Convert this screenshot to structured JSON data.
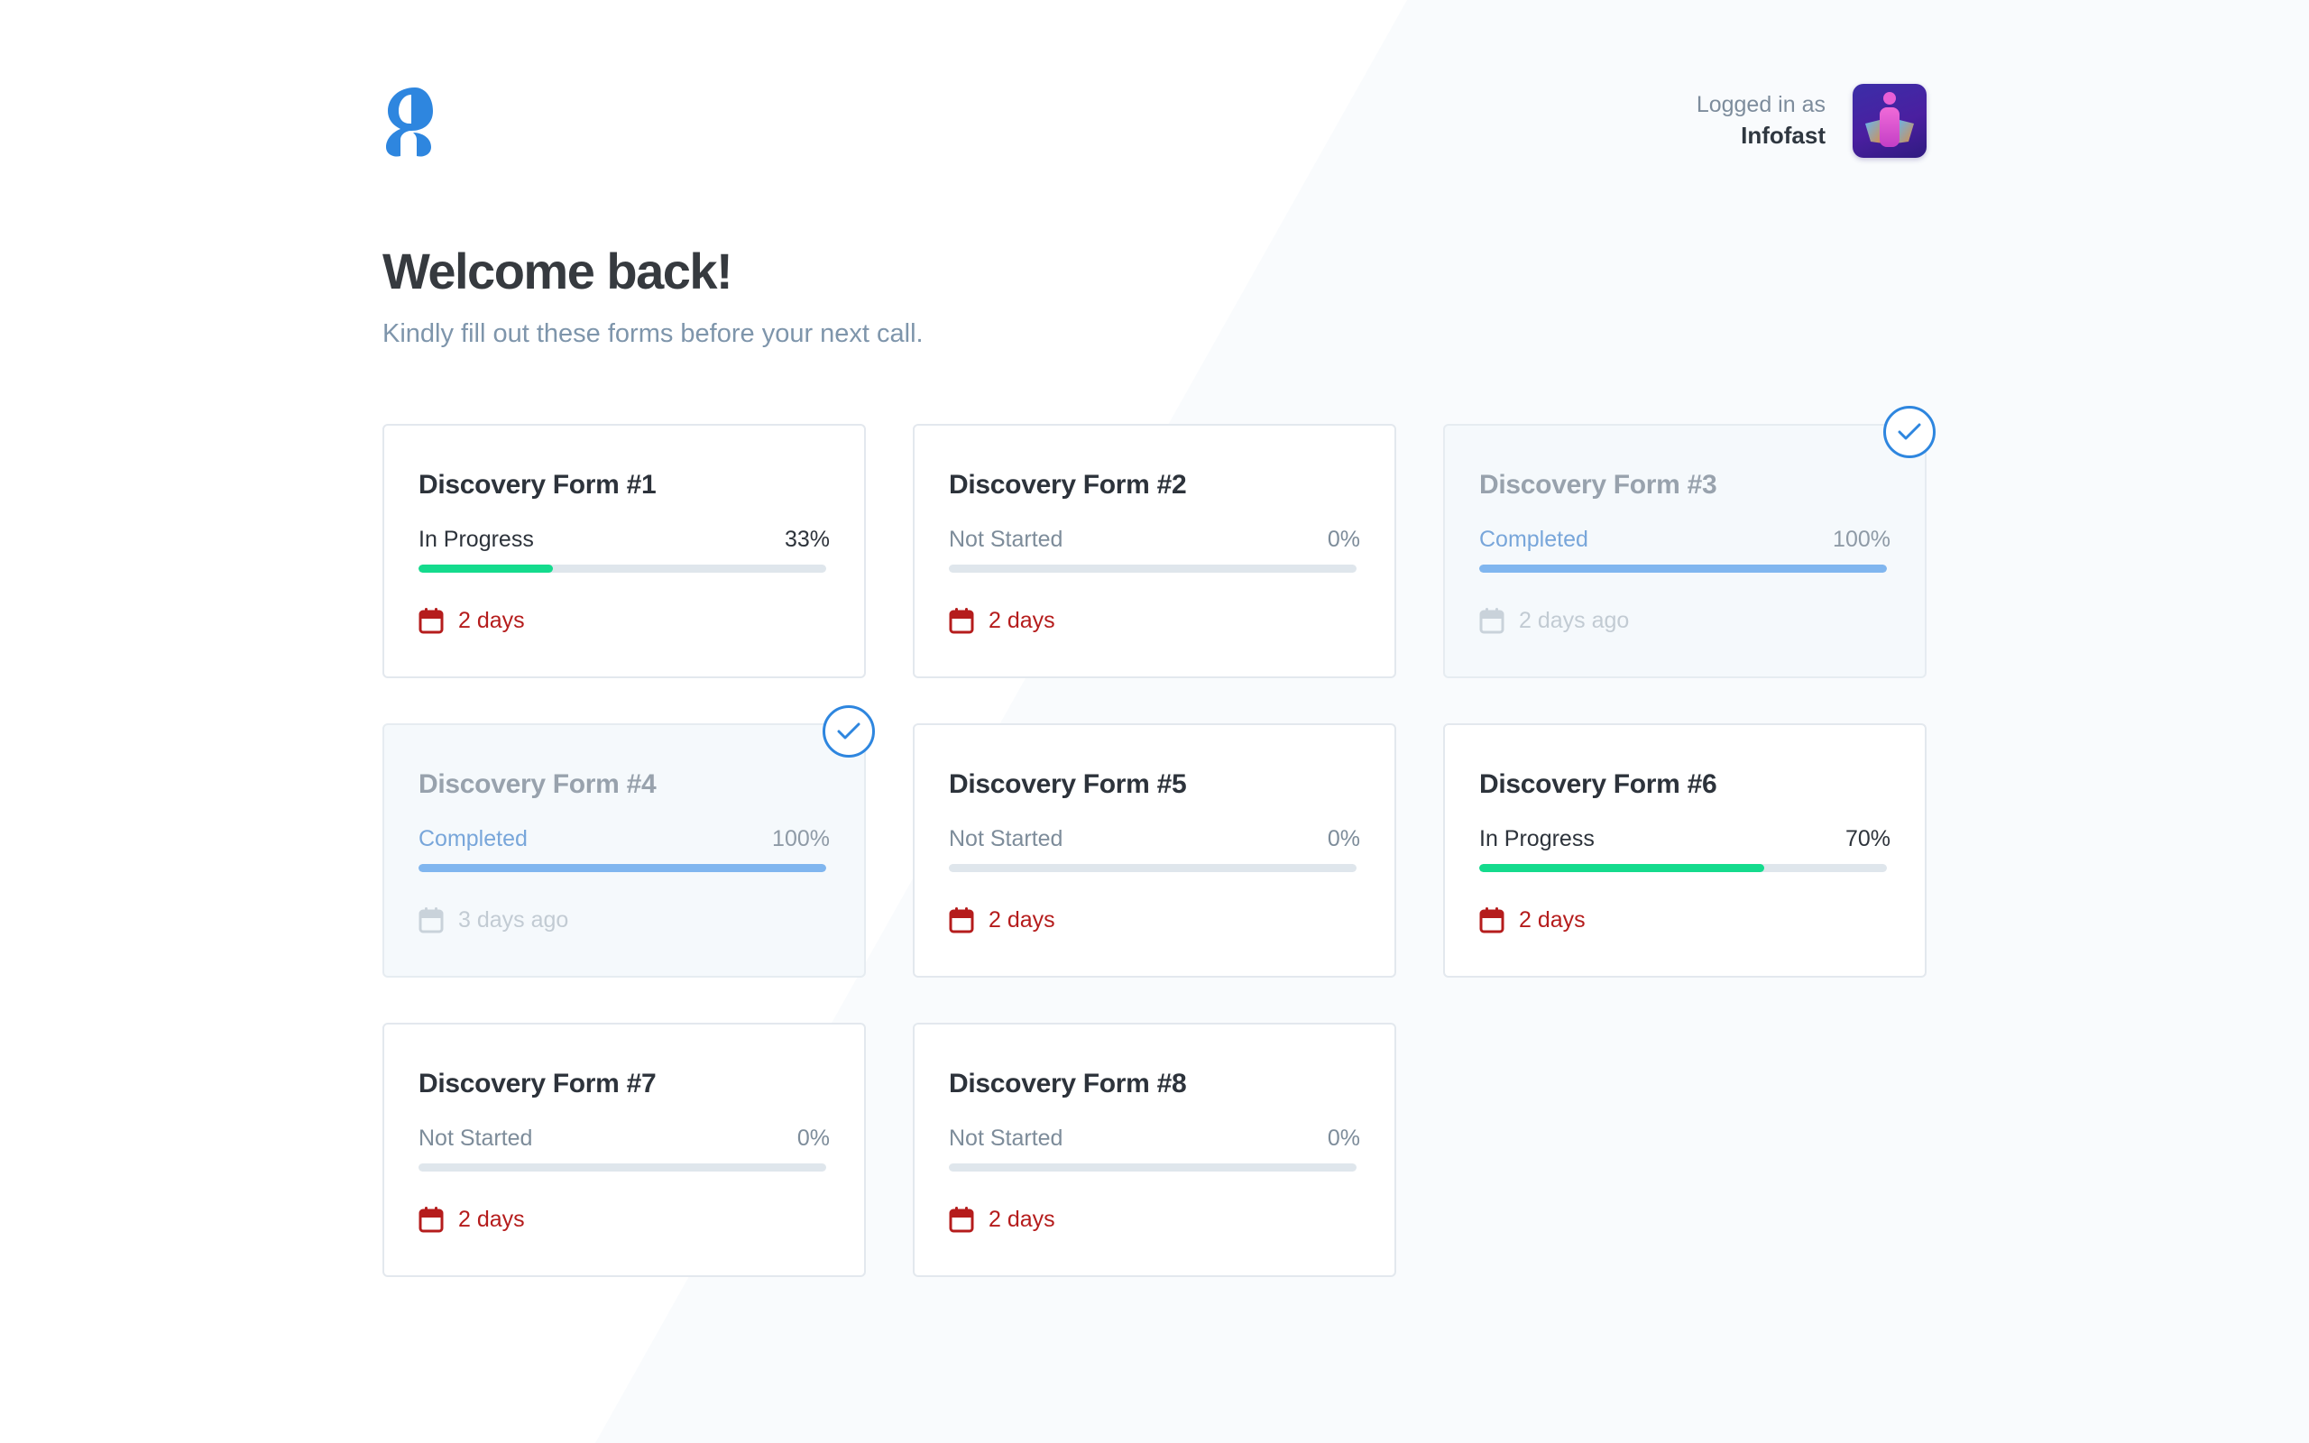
{
  "header": {
    "logo_icon": "brand-logo-icon",
    "user_caption": "Logged in as",
    "user_name": "Infofast",
    "avatar_icon": "user-avatar"
  },
  "welcome": {
    "title": "Welcome back!",
    "subtitle": "Kindly fill out these forms before your next call."
  },
  "forms": [
    {
      "title": "Discovery Form #1",
      "status": "In Progress",
      "percent_label": "33%",
      "progress": 0.33,
      "due": "2 days",
      "state": "in-progress"
    },
    {
      "title": "Discovery Form #2",
      "status": "Not Started",
      "percent_label": "0%",
      "progress": 0,
      "due": "2 days",
      "state": "not-started"
    },
    {
      "title": "Discovery Form #3",
      "status": "Completed",
      "percent_label": "100%",
      "progress": 1,
      "due": "2 days ago",
      "state": "completed"
    },
    {
      "title": "Discovery Form #4",
      "status": "Completed",
      "percent_label": "100%",
      "progress": 1,
      "due": "3 days ago",
      "state": "completed"
    },
    {
      "title": "Discovery Form #5",
      "status": "Not Started",
      "percent_label": "0%",
      "progress": 0,
      "due": "2 days",
      "state": "not-started"
    },
    {
      "title": "Discovery Form #6",
      "status": "In Progress",
      "percent_label": "70%",
      "progress": 0.7,
      "due": "2 days",
      "state": "in-progress"
    },
    {
      "title": "Discovery Form #7",
      "status": "Not Started",
      "percent_label": "0%",
      "progress": 0,
      "due": "2 days",
      "state": "not-started"
    },
    {
      "title": "Discovery Form #8",
      "status": "Not Started",
      "percent_label": "0%",
      "progress": 0,
      "due": "2 days",
      "state": "not-started"
    }
  ],
  "icons": {
    "calendar": "calendar-icon",
    "check": "checkmark-circle-icon"
  },
  "colors": {
    "brand_blue": "#2e86df",
    "in_progress_green": "#14db8d",
    "completed_blue": "#80b6ef",
    "due_red": "#b51c1c",
    "track_gray": "#dfe6ec"
  }
}
